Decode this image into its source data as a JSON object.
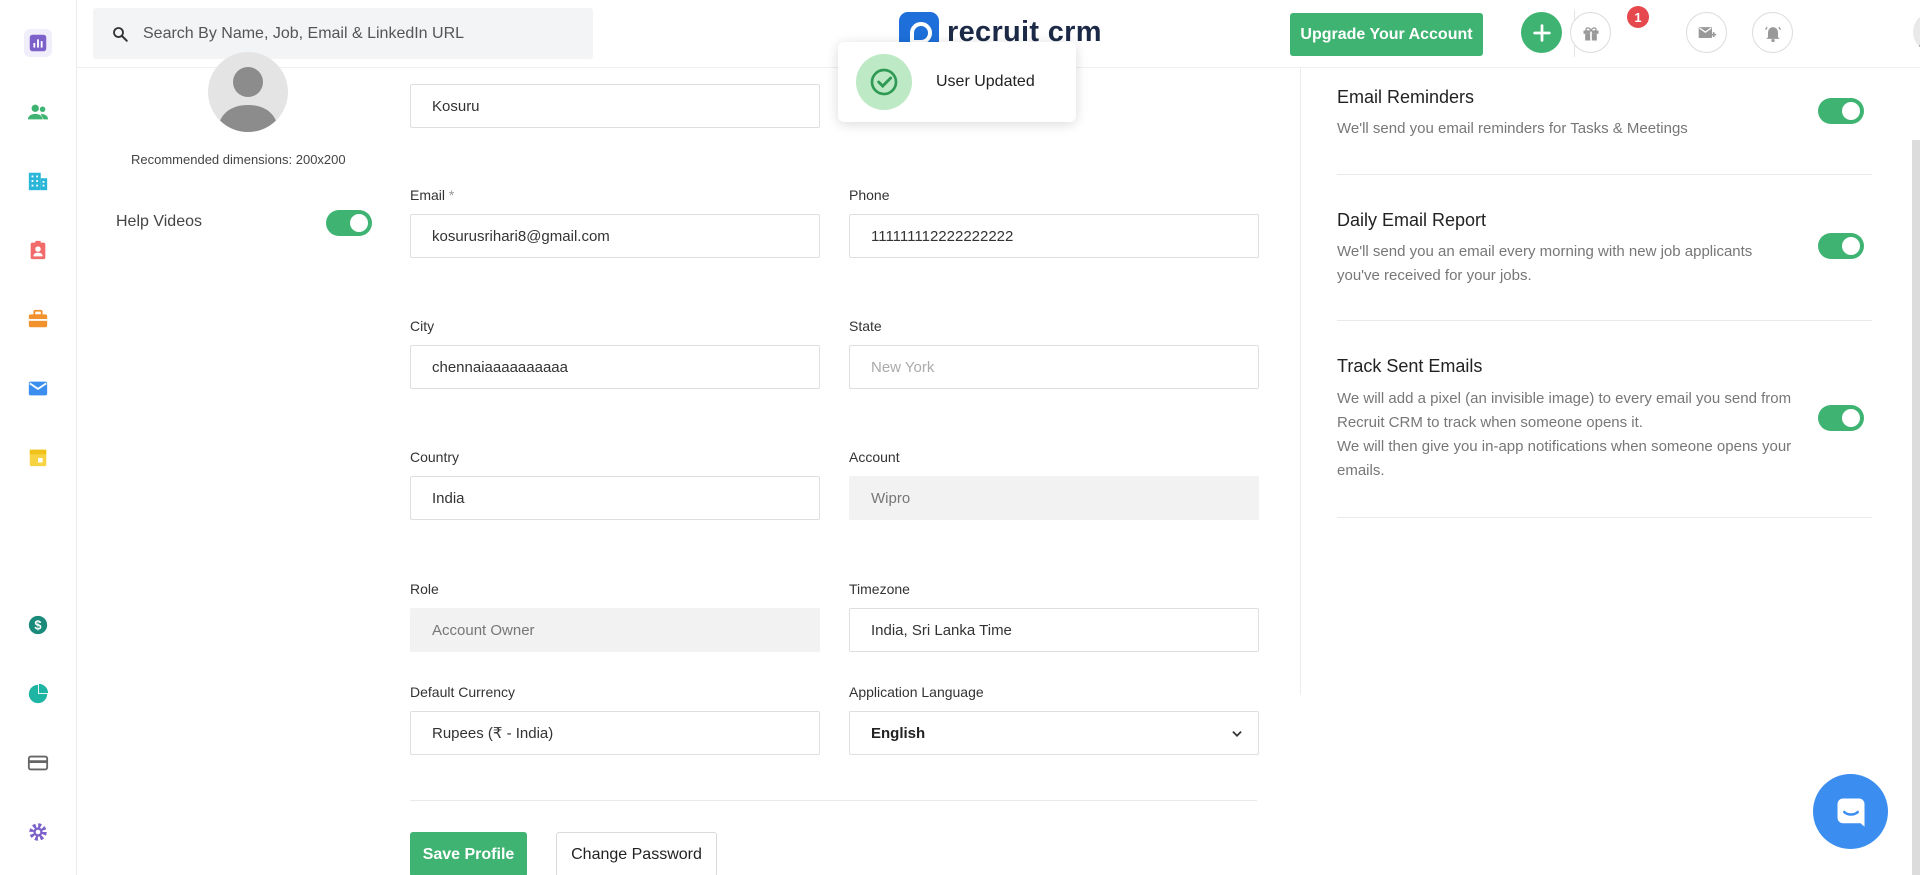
{
  "colors": {
    "brand_green": "#3fb472",
    "brand_blue": "#1e6fd9",
    "notif_red": "#e5484d",
    "chat_blue": "#3b8ef0"
  },
  "sidebar": {
    "items": [
      {
        "icon": "dashboard-icon",
        "color": "#7b61c9"
      },
      {
        "icon": "candidates-icon",
        "color": "#3fb472"
      },
      {
        "icon": "companies-icon",
        "color": "#29b6d8"
      },
      {
        "icon": "contacts-icon",
        "color": "#f26b6b"
      },
      {
        "icon": "jobs-icon",
        "color": "#f2922f"
      },
      {
        "icon": "email-icon",
        "color": "#3b8ef0"
      },
      {
        "icon": "calendar-icon",
        "color": "#f7d342"
      },
      {
        "icon": "billing-icon",
        "color": "#1a8a7a"
      },
      {
        "icon": "reports-icon",
        "color": "#1fb5a5"
      },
      {
        "icon": "card-icon",
        "color": "#666666"
      },
      {
        "icon": "settings-icon",
        "color": "#7b61c9"
      }
    ]
  },
  "header": {
    "search_placeholder": "Search By Name, Job, Email & LinkedIn URL",
    "logo_text": "recruit crm",
    "upgrade_label": "Upgrade Your Account",
    "notification_count": "1"
  },
  "toast": {
    "message": "User Updated"
  },
  "profile": {
    "recommended_dimensions": "Recommended dimensions: 200x200",
    "help_videos_label": "Help Videos",
    "help_videos_on": true
  },
  "form": {
    "last_name_value": "Kosuru",
    "email_label": "Email",
    "email_required": "*",
    "email_value": "kosurusrihari8@gmail.com",
    "phone_label": "Phone",
    "phone_value": "111111112222222222",
    "city_label": "City",
    "city_value": "chennaiaaaaaaaaaa",
    "state_label": "State",
    "state_placeholder": "New York",
    "country_label": "Country",
    "country_value": "India",
    "account_label": "Account",
    "account_value": "Wipro",
    "role_label": "Role",
    "role_value": "Account Owner",
    "timezone_label": "Timezone",
    "timezone_value": "India, Sri Lanka Time",
    "currency_label": "Default Currency",
    "currency_value": "Rupees (₹ - India)",
    "language_label": "Application Language",
    "language_value": "English",
    "save_label": "Save Profile",
    "change_password_label": "Change Password"
  },
  "settings": {
    "email_reminders_title": "Email Reminders",
    "email_reminders_desc": "We'll send you email reminders for Tasks & Meetings",
    "daily_report_title": "Daily Email Report",
    "daily_report_desc": "We'll send you an email every morning with new job applicants you've received for your jobs.",
    "track_emails_title": "Track Sent Emails",
    "track_emails_desc_1": "We will add a pixel (an invisible image) to every email you send from Recruit CRM to track when someone opens it.",
    "track_emails_desc_2": "We will then give you in-app notifications when someone opens your emails."
  }
}
